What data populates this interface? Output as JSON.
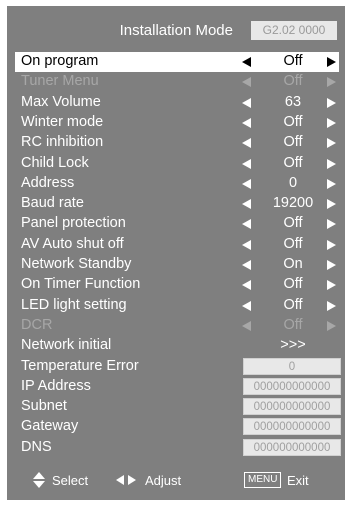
{
  "header": {
    "title": "Installation Mode",
    "version": "G2.02 0000"
  },
  "menu": {
    "items": [
      {
        "label": "On program",
        "value": "Off",
        "state": "selected"
      },
      {
        "label": "Tuner Menu",
        "value": "Off",
        "state": "disabled"
      },
      {
        "label": "Max Volume",
        "value": "63",
        "state": "normal"
      },
      {
        "label": "Winter mode",
        "value": "Off",
        "state": "normal"
      },
      {
        "label": "RC inhibition",
        "value": "Off",
        "state": "normal"
      },
      {
        "label": "Child Lock",
        "value": "Off",
        "state": "normal"
      },
      {
        "label": "Address",
        "value": "0",
        "state": "normal"
      },
      {
        "label": "Baud rate",
        "value": "19200",
        "state": "normal"
      },
      {
        "label": "Panel protection",
        "value": "Off",
        "state": "normal"
      },
      {
        "label": "AV Auto shut off",
        "value": "Off",
        "state": "normal"
      },
      {
        "label": "Network Standby",
        "value": "On",
        "state": "normal"
      },
      {
        "label": "On Timer Function",
        "value": "Off",
        "state": "normal"
      },
      {
        "label": "LED light setting",
        "value": "Off",
        "state": "normal"
      },
      {
        "label": "DCR",
        "value": "Off",
        "state": "disabled"
      }
    ],
    "network_initial": {
      "label": "Network initial",
      "value": ">>>"
    },
    "fields": [
      {
        "label": "Temperature Error",
        "value": "0"
      },
      {
        "label": "IP Address",
        "value": "000000000000"
      },
      {
        "label": "Subnet",
        "value": "000000000000"
      },
      {
        "label": "Gateway",
        "value": "000000000000"
      },
      {
        "label": "DNS",
        "value": "000000000000"
      }
    ]
  },
  "footer": {
    "select_label": "Select",
    "adjust_label": "Adjust",
    "menu_key": "MENU",
    "exit_label": "Exit"
  }
}
